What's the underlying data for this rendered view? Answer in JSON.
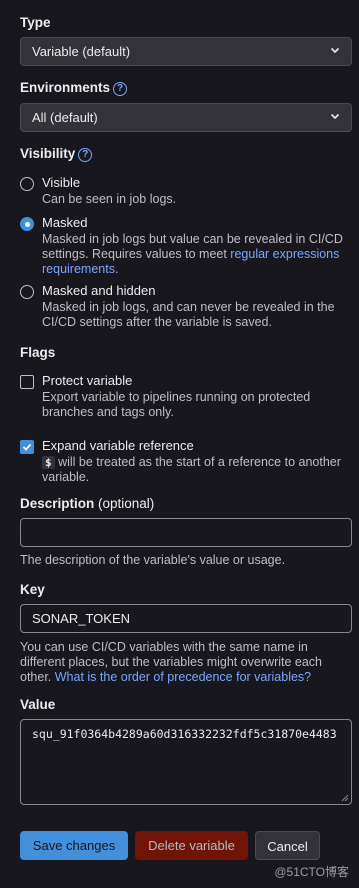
{
  "type": {
    "label": "Type",
    "value": "Variable (default)"
  },
  "environments": {
    "label": "Environments",
    "value": "All (default)"
  },
  "visibility": {
    "label": "Visibility",
    "options": [
      {
        "title": "Visible",
        "desc": "Can be seen in job logs.",
        "checked": false
      },
      {
        "title": "Masked",
        "desc": "Masked in job logs but value can be revealed in CI/CD settings. Requires values to meet ",
        "link": "regular expressions requirements",
        "desc_end": ".",
        "checked": true
      },
      {
        "title": "Masked and hidden",
        "desc": "Masked in job logs, and can never be revealed in the CI/CD settings after the variable is saved.",
        "checked": false
      }
    ]
  },
  "flags": {
    "label": "Flags",
    "protect": {
      "title": "Protect variable",
      "desc": "Export variable to pipelines running on protected branches and tags only.",
      "checked": false
    },
    "expand": {
      "title": "Expand variable reference",
      "code": "$",
      "desc": " will be treated as the start of a reference to another variable.",
      "checked": true
    }
  },
  "description": {
    "label": "Description",
    "label_opt": " (optional)",
    "value": "",
    "hint": "The description of the variable's value or usage."
  },
  "key": {
    "label": "Key",
    "value": "SONAR_TOKEN",
    "hint": "You can use CI/CD variables with the same name in different places, but the variables might overwrite each other. ",
    "hint_link": "What is the order of precedence for variables?"
  },
  "value": {
    "label": "Value",
    "text": "squ_91f0364b4289a60d316332232fdf5c31870e4483"
  },
  "buttons": {
    "save": "Save changes",
    "delete": "Delete variable",
    "cancel": "Cancel"
  },
  "watermark": "@51CTO博客",
  "colors": {
    "accent": "#428fdc",
    "danger": "#8d1300",
    "background": "#18171d",
    "link": "#7aa7ff"
  }
}
